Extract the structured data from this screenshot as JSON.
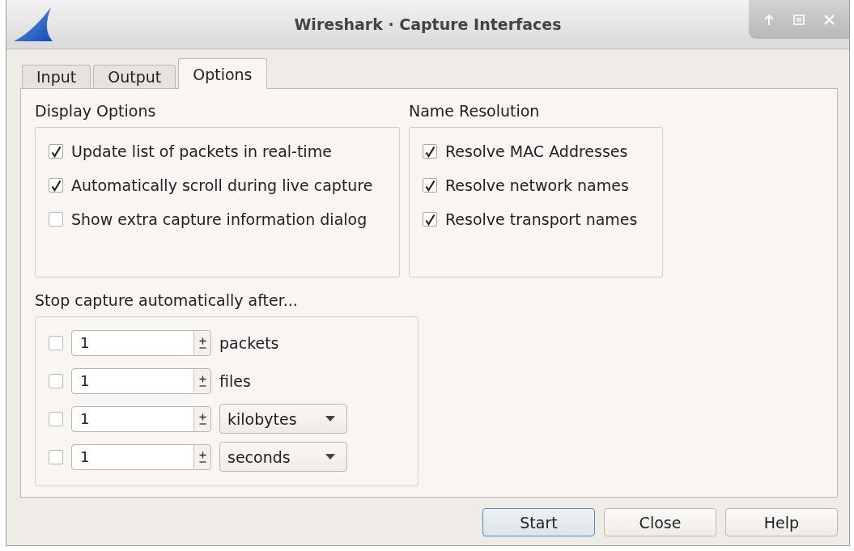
{
  "window": {
    "title": "Wireshark · Capture Interfaces"
  },
  "tabs": [
    {
      "label": "Input",
      "selected": false
    },
    {
      "label": "Output",
      "selected": false
    },
    {
      "label": "Options",
      "selected": true
    }
  ],
  "display_options": {
    "title": "Display Options",
    "items": [
      {
        "label": "Update list of packets in real-time",
        "checked": true
      },
      {
        "label": "Automatically scroll during live capture",
        "checked": true
      },
      {
        "label": "Show extra capture information dialog",
        "checked": false
      }
    ]
  },
  "name_resolution": {
    "title": "Name Resolution",
    "items": [
      {
        "label": "Resolve MAC Addresses",
        "checked": true
      },
      {
        "label": "Resolve network names",
        "checked": true
      },
      {
        "label": "Resolve transport names",
        "checked": true
      }
    ]
  },
  "stop_capture": {
    "title": "Stop capture automatically after...",
    "rows": [
      {
        "checked": false,
        "value": "1",
        "unit": "packets",
        "kind": "label"
      },
      {
        "checked": false,
        "value": "1",
        "unit": "files",
        "kind": "label"
      },
      {
        "checked": false,
        "value": "1",
        "unit": "kilobytes",
        "kind": "dropdown"
      },
      {
        "checked": false,
        "value": "1",
        "unit": "seconds",
        "kind": "dropdown"
      }
    ]
  },
  "buttons": [
    {
      "label": "Start",
      "default": true
    },
    {
      "label": "Close",
      "default": false
    },
    {
      "label": "Help",
      "default": false
    }
  ]
}
